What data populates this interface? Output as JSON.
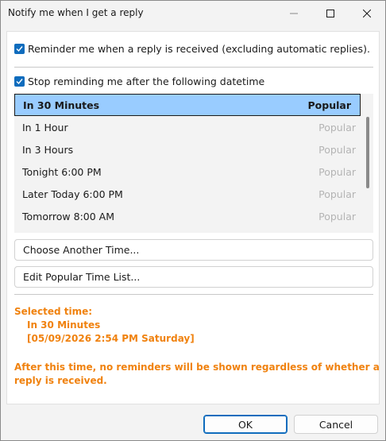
{
  "window": {
    "title": "Notify me when I get a reply"
  },
  "options": {
    "reminder_label": "Reminder me when a reply is received (excluding automatic replies).",
    "reminder_checked": true,
    "stop_label": "Stop reminding me after the following datetime",
    "stop_checked": true
  },
  "time_list": {
    "items": [
      {
        "label": "In 30 Minutes",
        "tag": "Popular",
        "selected": true
      },
      {
        "label": "In 1 Hour",
        "tag": "Popular",
        "selected": false
      },
      {
        "label": "In 3 Hours",
        "tag": "Popular",
        "selected": false
      },
      {
        "label": "Tonight 6:00 PM",
        "tag": "Popular",
        "selected": false
      },
      {
        "label": "Later Today 6:00 PM",
        "tag": "Popular",
        "selected": false
      },
      {
        "label": "Tomorrow 8:00 AM",
        "tag": "Popular",
        "selected": false
      }
    ]
  },
  "actions": {
    "choose_another": "Choose Another Time...",
    "edit_popular": "Edit Popular Time List..."
  },
  "info": {
    "selected_heading": "Selected time:",
    "selected_value": "In 30 Minutes",
    "selected_datetime": "[05/09/2026 2:54 PM Saturday]",
    "warning": "After this time, no reminders will be shown regardless of whether a reply is received."
  },
  "footer": {
    "ok_label": "OK",
    "cancel_label": "Cancel"
  },
  "colors": {
    "accent": "#0f6cbd",
    "selection": "#99ccff",
    "info_text": "#f0820f"
  }
}
